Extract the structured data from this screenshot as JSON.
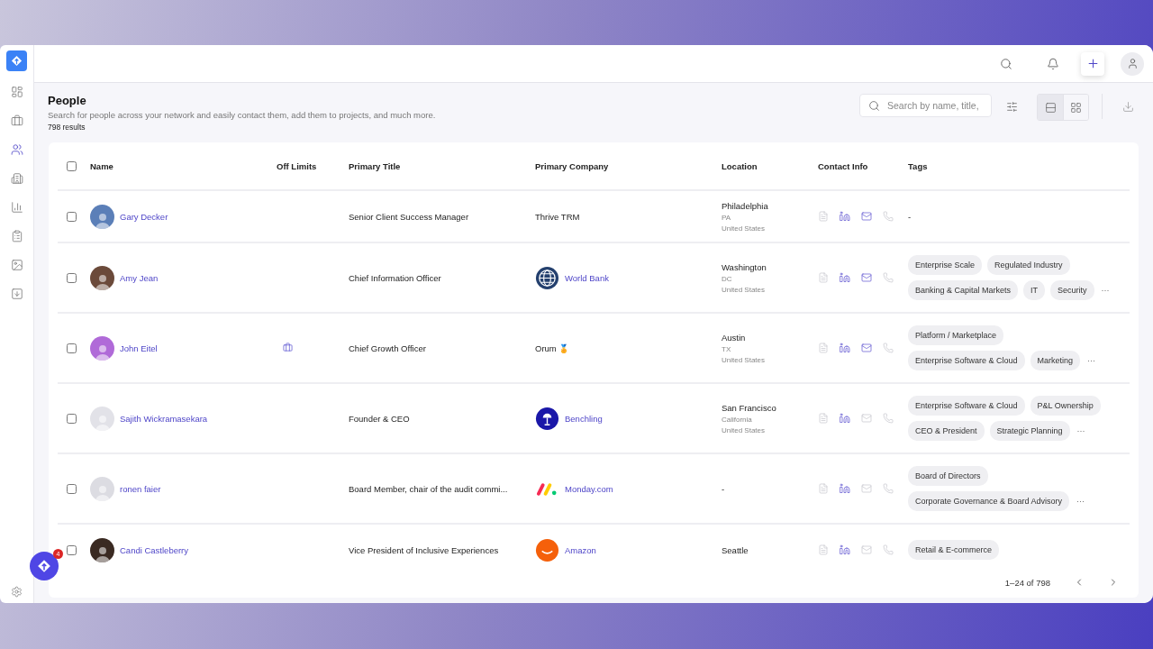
{
  "sidebar": {
    "items": [
      {
        "selected": false
      },
      {
        "selected": false
      },
      {
        "selected": true
      },
      {
        "selected": false
      },
      {
        "selected": false
      },
      {
        "selected": false
      },
      {
        "selected": false
      },
      {
        "selected": false
      }
    ]
  },
  "fab": {
    "badge": "4"
  },
  "page": {
    "title": "People",
    "subtitle": "Search for people across your network and easily contact them, add them to projects, and much more.",
    "count": "798 results"
  },
  "search": {
    "placeholder": "Search by name, title,"
  },
  "view_toggle": [
    {
      "kind": "list",
      "selected": true
    },
    {
      "kind": "grid",
      "selected": false
    }
  ],
  "table": {
    "select_all": {
      "checked": false
    },
    "columns": [
      "Name",
      "Off Limits",
      "Primary Title",
      "Primary Company",
      "Location",
      "Contact Info",
      "Tags"
    ],
    "rows": [
      {
        "checked": false,
        "name": "Gary Decker",
        "off_limits": false,
        "title": "Senior Client Success Manager",
        "company": {
          "name": "Thrive TRM",
          "kind": "plain",
          "link": false
        },
        "location": [
          "Philadelphia",
          "PA",
          "United States"
        ],
        "contact": {
          "resume": false,
          "linkedin": true,
          "email": true,
          "phone": false
        },
        "tags": [],
        "no_tags": "-"
      },
      {
        "checked": false,
        "name": "Amy Jean",
        "off_limits": false,
        "title": "Chief Information Officer",
        "company": {
          "name": "World Bank",
          "kind": "globe",
          "link": true
        },
        "location": [
          "Washington",
          "DC",
          "United States"
        ],
        "contact": {
          "resume": false,
          "linkedin": true,
          "email": true,
          "phone": false
        },
        "tags": [
          "Enterprise Scale",
          "Regulated Industry",
          "Banking & Capital Markets",
          "IT",
          "Security"
        ],
        "more": "···"
      },
      {
        "checked": false,
        "name": "John Eitel",
        "off_limits": true,
        "title": "Chief Growth Officer",
        "company": {
          "name": "Orum 🏅",
          "kind": "plain",
          "link": false
        },
        "location": [
          "Austin",
          "TX",
          "United States"
        ],
        "contact": {
          "resume": false,
          "linkedin": true,
          "email": true,
          "phone": false
        },
        "tags": [
          "Platform / Marketplace",
          "Enterprise Software & Cloud",
          "Marketing"
        ],
        "more": "···"
      },
      {
        "checked": false,
        "name": "Sajith Wickramasekara",
        "off_limits": false,
        "title": "Founder & CEO",
        "company": {
          "name": "Benchling",
          "kind": "lamp",
          "link": true
        },
        "location": [
          "San Francisco",
          "California",
          "United States"
        ],
        "contact": {
          "resume": false,
          "linkedin": true,
          "email": false,
          "phone": false
        },
        "tags": [
          "Enterprise Software & Cloud",
          "P&L Ownership",
          "CEO & President",
          "Strategic Planning"
        ],
        "more": "···"
      },
      {
        "checked": false,
        "name": "ronen faier",
        "off_limits": false,
        "title": "Board Member, chair of the audit commi...",
        "company": {
          "name": "Monday.com",
          "kind": "stripes",
          "link": true
        },
        "location": [
          "-"
        ],
        "contact": {
          "resume": false,
          "linkedin": true,
          "email": false,
          "phone": false
        },
        "tags": [
          "Board of Directors",
          "Corporate Governance & Board Advisory"
        ],
        "more": "···"
      },
      {
        "checked": false,
        "name": "Candi Castleberry",
        "off_limits": false,
        "title": "Vice President of Inclusive Experiences",
        "company": {
          "name": "Amazon",
          "kind": "smile",
          "link": true
        },
        "location": [
          "Seattle"
        ],
        "contact": {
          "resume": false,
          "linkedin": true,
          "email": false,
          "phone": false
        },
        "tags": [
          "Retail & E-commerce"
        ]
      }
    ]
  },
  "pagination": {
    "range": "1–24 of 798"
  }
}
